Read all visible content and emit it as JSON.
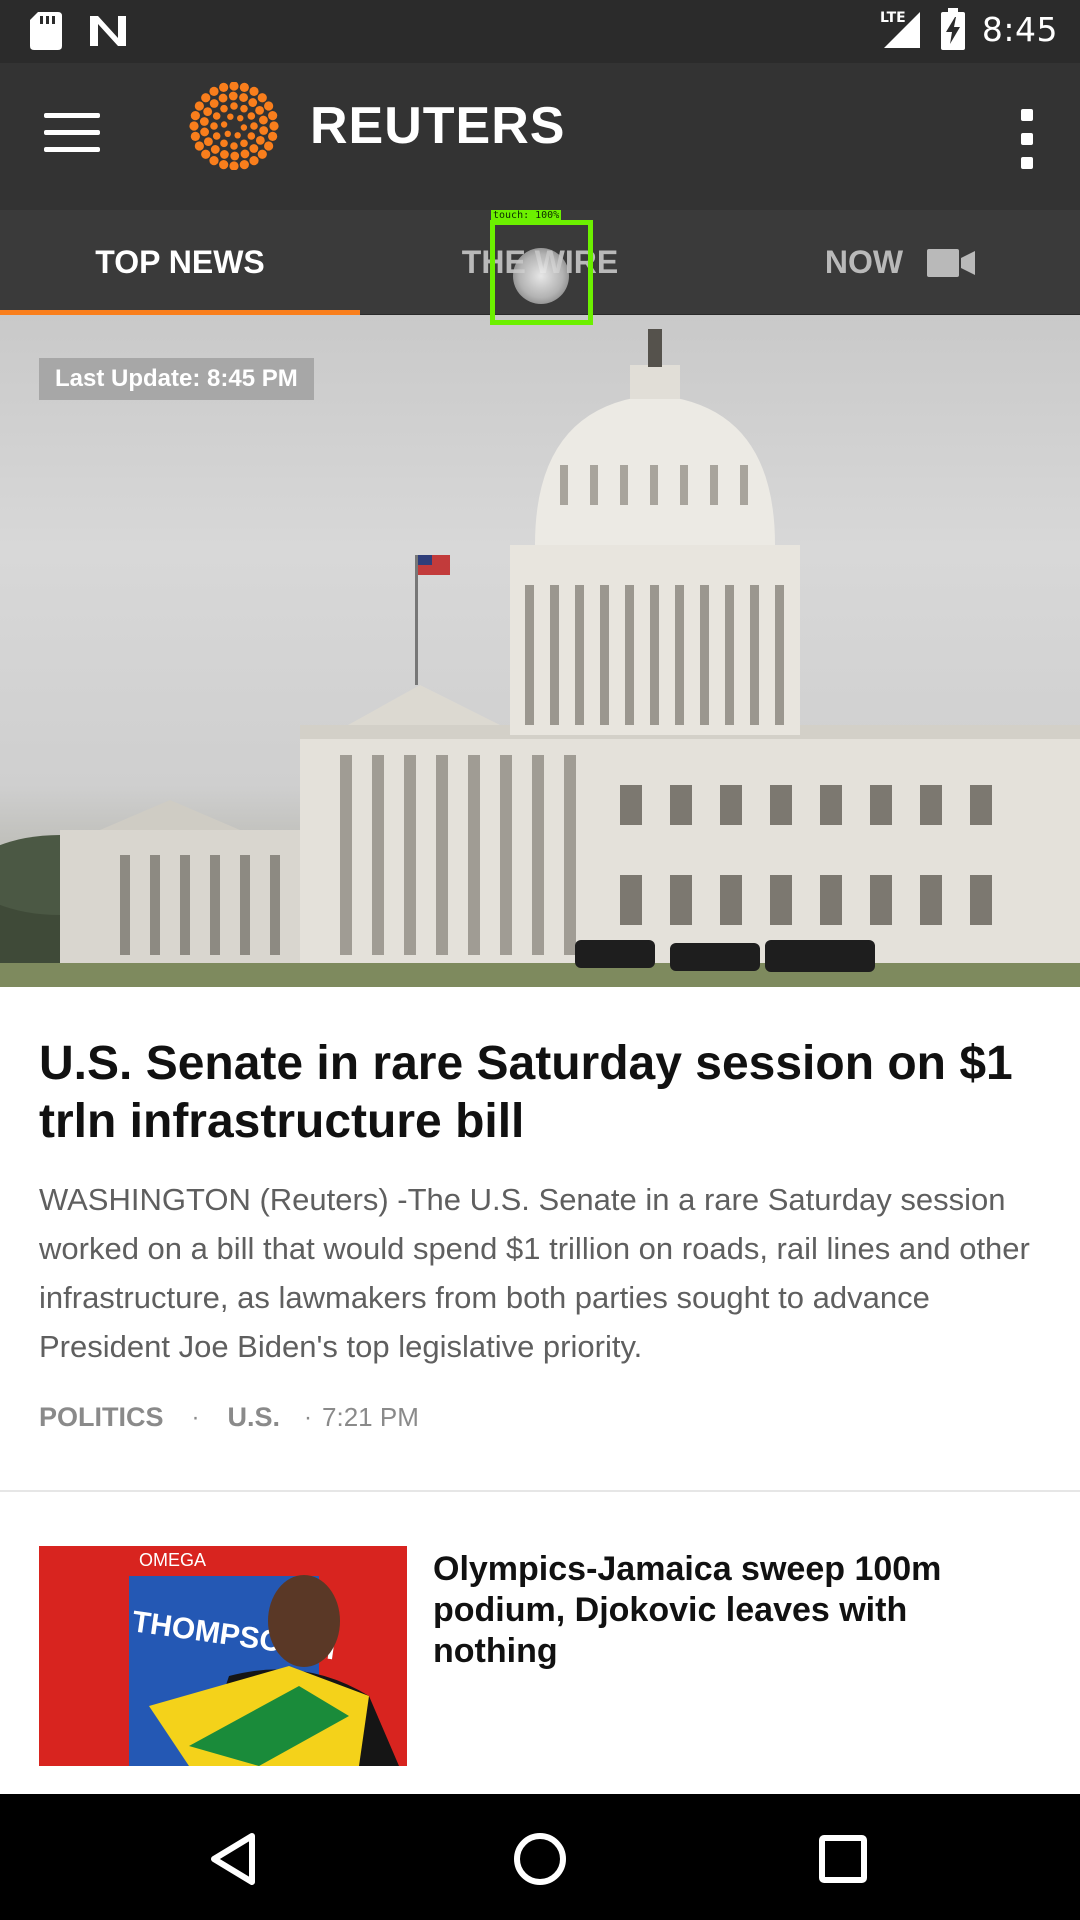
{
  "status_bar": {
    "time": "8:45",
    "network_label": "LTE",
    "icons": [
      "sd-card-icon",
      "n-notification-icon",
      "signal-icon",
      "battery-charging-icon"
    ]
  },
  "app_bar": {
    "brand_name": "REUTERS",
    "brand_color": "#f97e1c",
    "icons": [
      "hamburger-menu-icon",
      "reuters-logo",
      "overflow-menu-icon"
    ]
  },
  "tabs": [
    {
      "label": "TOP NEWS",
      "active": true
    },
    {
      "label": "THE WIRE",
      "active": false
    },
    {
      "label": "NOW",
      "active": false,
      "icon": "video-camera-icon"
    }
  ],
  "touch_indicator": {
    "label": "touch: 100%"
  },
  "hero": {
    "last_update": "Last Update: 8:45 PM"
  },
  "lead_story": {
    "title": "U.S. Senate in rare Saturday session on $1 trln infrastructure bill",
    "summary": "WASHINGTON (Reuters) -The U.S. Senate in a rare Saturday session worked on a bill that would spend $1 trillion on roads, rail lines and other infrastructure, as lawmakers from both parties sought to advance President Joe Biden's top legislative priority.",
    "tag1": "POLITICS",
    "tag2": "U.S.",
    "separator": "·",
    "time": "7:21 PM"
  },
  "second_story": {
    "title": "Olympics-Jamaica sweep 100m podium, Djokovic leaves with nothing",
    "thumb_text_1": "THOMPSON-H",
    "thumb_text_2": "OMEGA"
  },
  "nav_bar": {
    "icons": [
      "back-icon",
      "home-icon",
      "recents-icon"
    ]
  }
}
